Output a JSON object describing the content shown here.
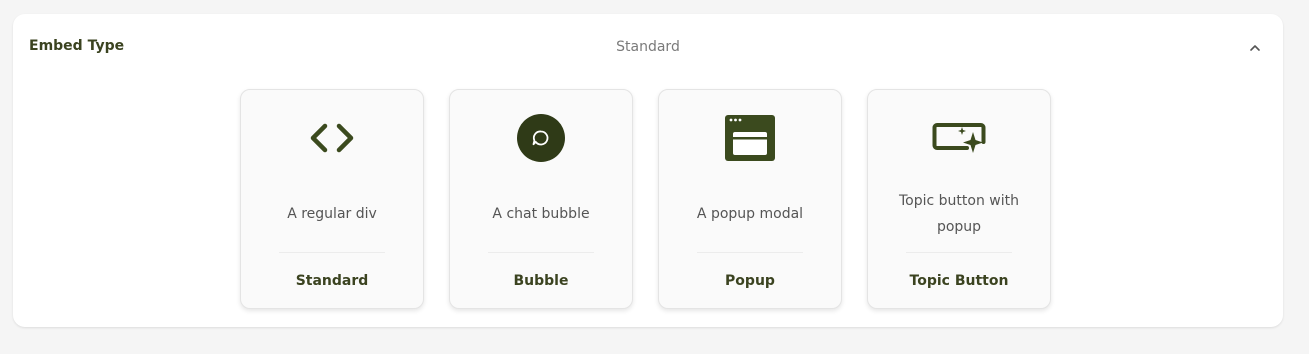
{
  "embed": {
    "title": "Embed Type",
    "selected": "Standard"
  },
  "colors": {
    "accent": "#3b4320",
    "icon": "#3b4a1e"
  },
  "options": [
    {
      "icon": "code-icon",
      "description": "A regular div",
      "label": "Standard"
    },
    {
      "icon": "chat-bubble-icon",
      "description": "A chat bubble",
      "label": "Bubble"
    },
    {
      "icon": "popup-window-icon",
      "description": "A popup modal",
      "label": "Popup"
    },
    {
      "icon": "topic-button-icon",
      "description": "Topic button with popup",
      "label": "Topic Button"
    }
  ]
}
